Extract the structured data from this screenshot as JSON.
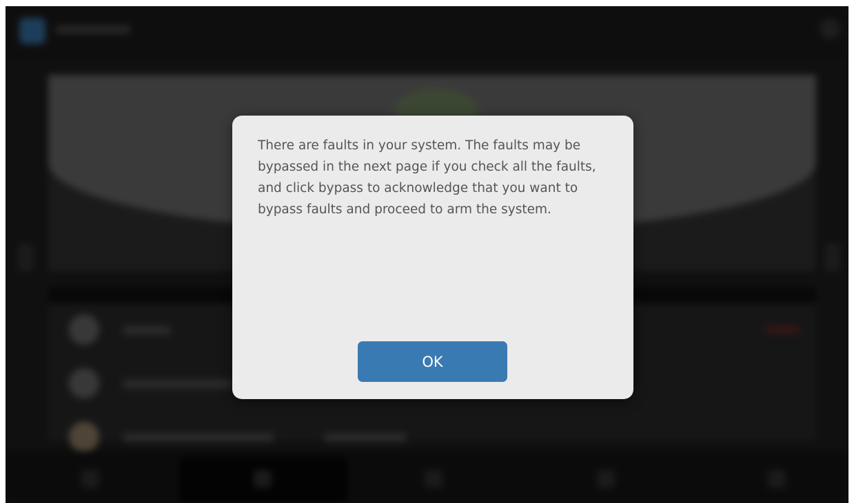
{
  "dialog": {
    "message": "There are faults in your system. The faults may be bypassed in the next page if you check all the faults, and click bypass to acknowledge that you want to bypass faults and proceed to arm the system.",
    "ok_label": "OK"
  },
  "colors": {
    "dialog_background": "#ebebeb",
    "button_accent": "#3a7ab3",
    "text": "#555555"
  }
}
